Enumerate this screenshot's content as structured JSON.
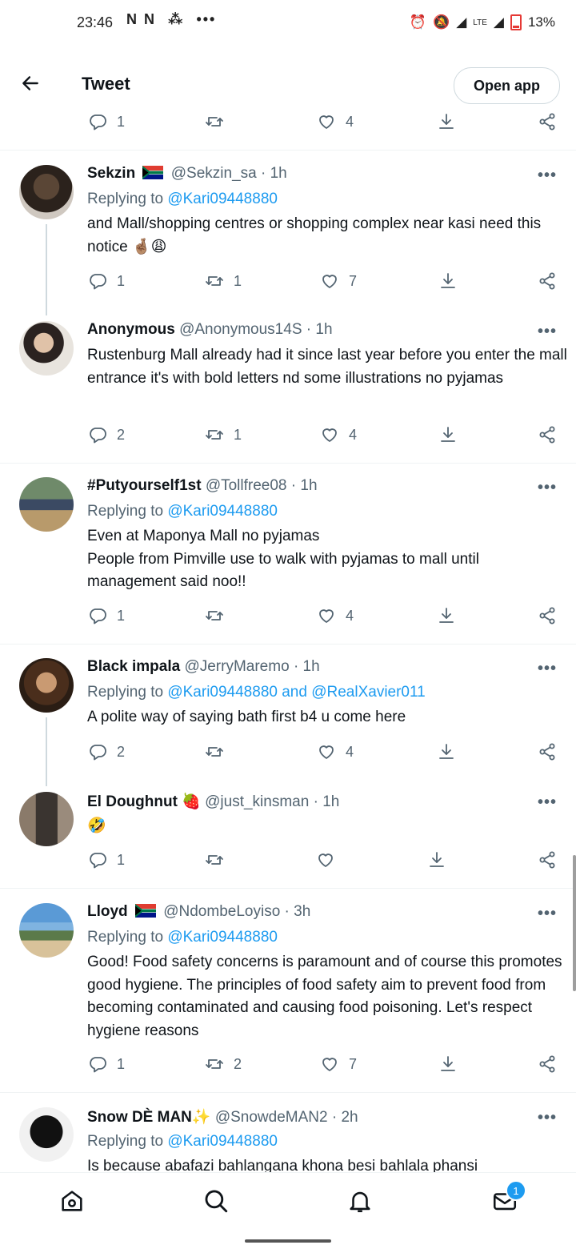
{
  "status_bar": {
    "time": "23:46",
    "left_icons": "N N",
    "more_dots": "•••",
    "network": "LTE",
    "battery": "13%"
  },
  "header": {
    "title": "Tweet",
    "open_app_label": "Open app"
  },
  "top_actions": {
    "replies": "1",
    "retweets": "",
    "likes": "4"
  },
  "tweets": [
    {
      "name": "Sekzin",
      "handle": "@Sekzin_sa",
      "sep": "·",
      "time": "1h",
      "replying_prefix": "Replying to",
      "replying_to": "@Kari09448880",
      "text": "and Mall/shopping centres or shopping complex near kasi need this notice 🤞🏽😩",
      "replies": "1",
      "retweets": "1",
      "likes": "7"
    },
    {
      "name": "Anonymous",
      "handle": "@Anonymous14S",
      "sep": "·",
      "time": "1h",
      "text": "Rustenburg Mall already had it since last year before you enter the mall entrance it's with bold letters nd some illustrations no pyjamas",
      "replies": "2",
      "retweets": "1",
      "likes": "4"
    },
    {
      "name": "#Putyourself1st",
      "handle": "@Tollfree08",
      "sep": "·",
      "time": "1h",
      "replying_prefix": "Replying to",
      "replying_to": "@Kari09448880",
      "text": "Even at Maponya Mall no pyjamas\nPeople from Pimville use to walk with pyjamas to mall until management said noo!!",
      "replies": "1",
      "retweets": "",
      "likes": "4"
    },
    {
      "name": "Black impala",
      "handle": "@JerryMaremo",
      "sep": "·",
      "time": "1h",
      "replying_prefix": "Replying to",
      "replying_to": "@Kari09448880 and @RealXavier011",
      "text": "A polite way of saying bath first b4 u come here",
      "replies": "2",
      "retweets": "",
      "likes": "4"
    },
    {
      "name": "El Doughnut 🍓",
      "handle": "@just_kinsman",
      "sep": "·",
      "time": "1h",
      "text": "🤣",
      "replies": "1",
      "retweets": "",
      "likes": ""
    },
    {
      "name": "Lloyd",
      "handle": "@NdombeLoyiso",
      "sep": "·",
      "time": "3h",
      "replying_prefix": "Replying to",
      "replying_to": "@Kari09448880",
      "text": "Good! Food safety concerns is paramount and of course this promotes good hygiene. The principles of food safety aim to prevent food from becoming contaminated and causing food poisoning. Let's respect hygiene reasons",
      "replies": "1",
      "retweets": "2",
      "likes": "7"
    },
    {
      "name": "Snow DÈ MAN✨",
      "handle": "@SnowdeMAN2",
      "sep": "·",
      "time": "2h",
      "replying_prefix": "Replying to",
      "replying_to": "@Kari09448880",
      "text": "Is because abafazi bahlangana khona besi bahlala phansi"
    }
  ],
  "more_label": "•••",
  "bottom_nav": {
    "home_icon": "home-icon",
    "search_icon": "search-icon",
    "notifications_icon": "bell-icon",
    "messages_icon": "mail-icon",
    "messages_badge": "1"
  },
  "colors": {
    "accent": "#1d9bf0",
    "muted": "#536471",
    "text": "#0f1419"
  }
}
